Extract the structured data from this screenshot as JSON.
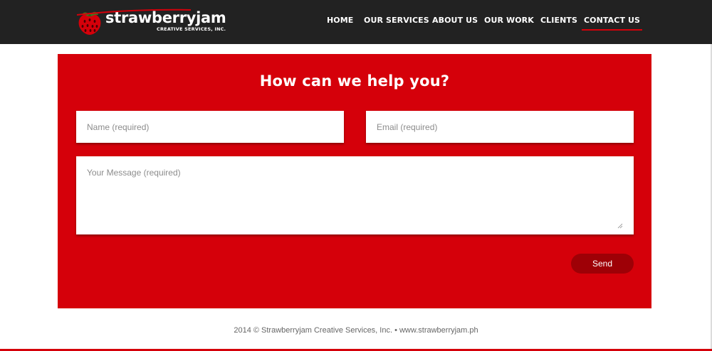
{
  "brand": {
    "name": "strawberryjam",
    "subtitle": "CREATIVE SERVICES, INC.",
    "logo_icon": "strawberry-icon"
  },
  "nav": {
    "items": [
      {
        "label": "HOME"
      },
      {
        "label": "OUR SERVICES"
      },
      {
        "label": "ABOUT US"
      },
      {
        "label": "OUR WORK"
      },
      {
        "label": "CLIENTS"
      },
      {
        "label": "CONTACT US",
        "active": true
      }
    ]
  },
  "contact": {
    "title": "How can we help you?",
    "name_placeholder": "Name (required)",
    "name_value": "",
    "email_placeholder": "Email (required)",
    "email_value": "",
    "message_placeholder": "Your Message (required)",
    "message_value": "",
    "send_label": "Send"
  },
  "footer": {
    "text": "2014 © Strawberryjam Creative Services, Inc. • www.strawberryjam.ph"
  },
  "colors": {
    "header_bg": "#222222",
    "accent_red": "#d5000a",
    "button_dark_red": "#9e0006",
    "footer_text": "#666666"
  }
}
